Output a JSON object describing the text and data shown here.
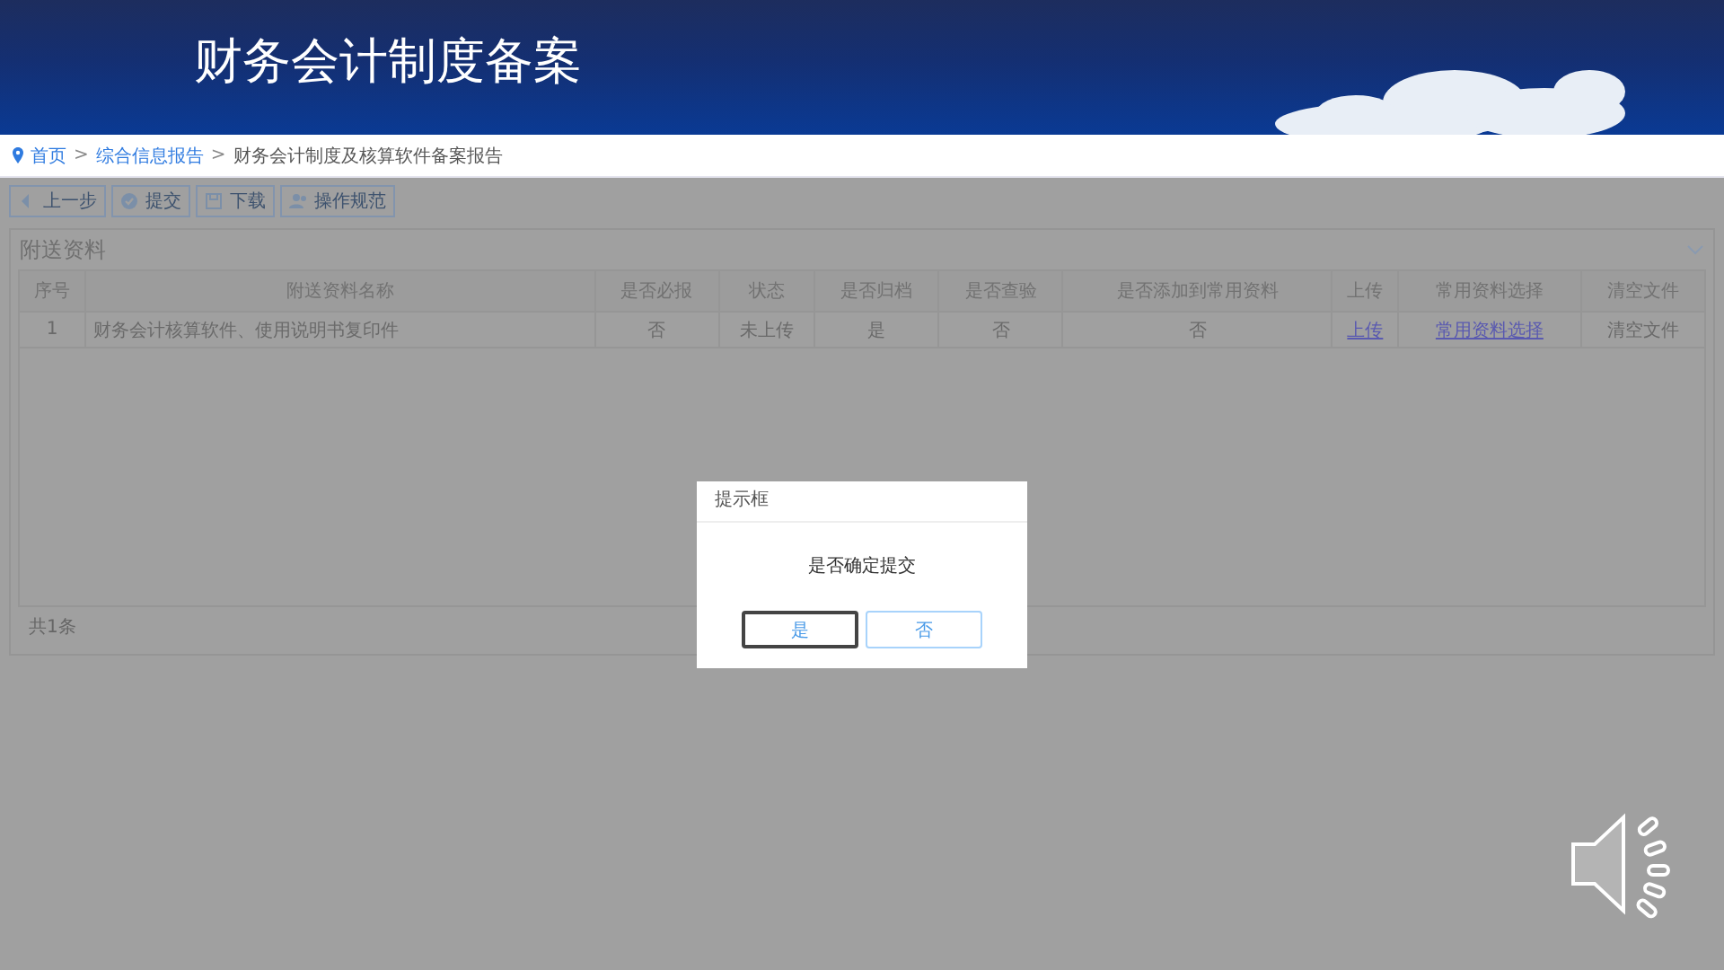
{
  "banner": {
    "title": "财务会计制度备案"
  },
  "breadcrumb": {
    "separator": ">",
    "items": [
      {
        "label": "首页",
        "link": true
      },
      {
        "label": "综合信息报告",
        "link": true
      },
      {
        "label": "财务会计制度及核算软件备案报告",
        "link": false
      }
    ]
  },
  "toolbar": [
    {
      "label": "上一步",
      "kind": "back"
    },
    {
      "label": "提交",
      "kind": "check"
    },
    {
      "label": "下载",
      "kind": "save"
    },
    {
      "label": "操作规范",
      "kind": "people"
    }
  ],
  "panel": {
    "title": "附送资料",
    "expanded": true
  },
  "table": {
    "columns": [
      "序号",
      "附送资料名称",
      "是否必报",
      "状态",
      "是否归档",
      "是否查验",
      "是否添加到常用资料",
      "上传",
      "常用资料选择",
      "清空文件"
    ],
    "rows": [
      [
        {
          "text": "1",
          "kind": "text"
        },
        {
          "text": "财务会计核算软件、使用说明书复印件",
          "kind": "text"
        },
        {
          "text": "否",
          "kind": "text"
        },
        {
          "text": "未上传",
          "kind": "text"
        },
        {
          "text": "是",
          "kind": "text"
        },
        {
          "text": "否",
          "kind": "text"
        },
        {
          "text": "否",
          "kind": "text"
        },
        {
          "text": "上传",
          "kind": "link"
        },
        {
          "text": "常用资料选择",
          "kind": "link"
        },
        {
          "text": "清空文件",
          "kind": "text"
        }
      ]
    ]
  },
  "footer": {
    "total": "共1条"
  },
  "dialog": {
    "title": "提示框",
    "message": "是否确定提交",
    "buttons": [
      {
        "label": "是",
        "focused": true
      },
      {
        "label": "否",
        "focused": false
      }
    ]
  }
}
